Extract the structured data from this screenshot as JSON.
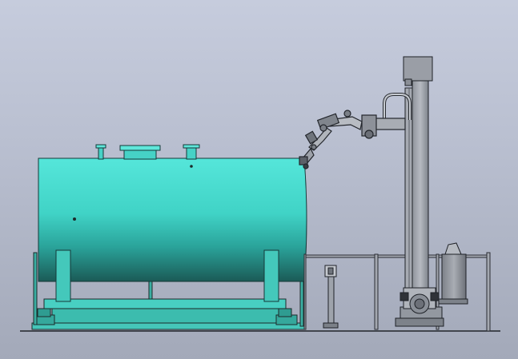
{
  "viewport": {
    "background_top": "#c6ccdd",
    "background_bottom": "#a3a9b9"
  },
  "scene": {
    "description_kind": "cad-3d-side-view",
    "objects": [
      {
        "name": "tank",
        "color": "#3fd2c5"
      },
      {
        "name": "tank-skid",
        "color": "#42c6b8"
      },
      {
        "name": "robot-arm",
        "color": "#8a8f98"
      },
      {
        "name": "gantry-column",
        "color": "#9a9ea6"
      },
      {
        "name": "machine-frame",
        "color": "#a8acb4"
      }
    ]
  }
}
